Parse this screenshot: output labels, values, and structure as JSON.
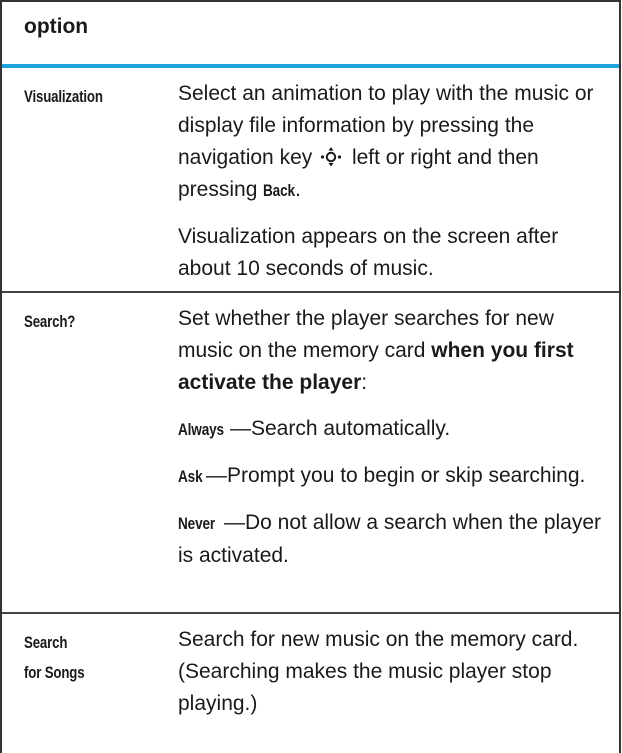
{
  "header": {
    "label": "option"
  },
  "rows": [
    {
      "term": "Visualization",
      "p1_before": "Select an animation to play with the music or display file information by pressing the navigation key",
      "p1_icon": "navigation-key-icon",
      "p1_mid": "left or right and then pressing",
      "p1_key": "Back",
      "p1_end": ".",
      "p2": "Visualization appears on the screen after about 10 seconds of music."
    },
    {
      "term": "Search?",
      "p1_text": "Set whether the player searches for new music on the memory card",
      "p1_bold": "when you first activate the player",
      "p1_end": ":",
      "options": [
        {
          "key": "Always",
          "text": "—Search automatically."
        },
        {
          "key": "Ask",
          "text": "—Prompt you to begin or skip searching."
        },
        {
          "key": "Never",
          "text": "—Do not allow a search when the player is activated."
        }
      ]
    },
    {
      "term_line1": "Search",
      "term_line2": "for Songs",
      "p1": "Search for new music on the memory card. (Searching makes the music player stop playing.)"
    }
  ],
  "colors": {
    "accent": "#1ca3dd",
    "text": "#1a1a1a",
    "rule": "#333333"
  }
}
